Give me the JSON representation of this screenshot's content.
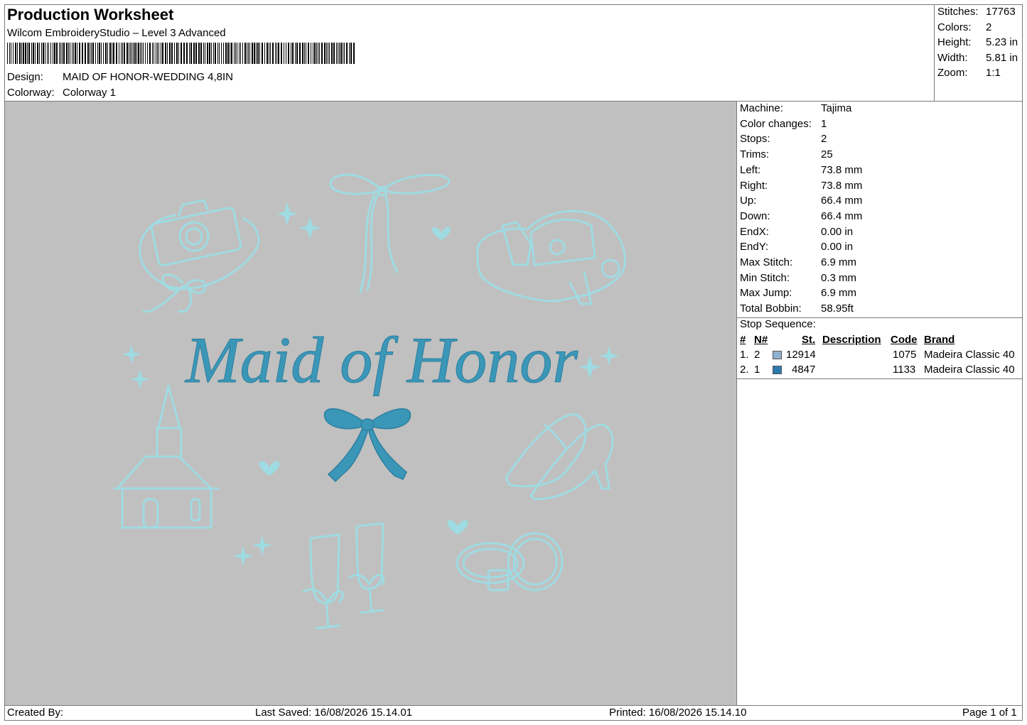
{
  "header": {
    "title": "Production Worksheet",
    "software": "Wilcom EmbroideryStudio – Level 3 Advanced",
    "design_label": "Design:",
    "design_value": "MAID OF HONOR-WEDDING 4,8IN",
    "colorway_label": "Colorway:",
    "colorway_value": "Colorway 1"
  },
  "summary": [
    {
      "label": "Stitches:",
      "value": "17763"
    },
    {
      "label": "Colors:",
      "value": "2"
    },
    {
      "label": "Height:",
      "value": "5.23 in"
    },
    {
      "label": "Width:",
      "value": "5.81 in"
    },
    {
      "label": "Zoom:",
      "value": "1:1"
    }
  ],
  "machine_info": [
    {
      "label": "Machine:",
      "value": "Tajima"
    },
    {
      "label": "Color changes:",
      "value": "1"
    },
    {
      "label": "Stops:",
      "value": "2"
    },
    {
      "label": "Trims:",
      "value": "25"
    },
    {
      "label": "Left:",
      "value": "73.8 mm"
    },
    {
      "label": "Right:",
      "value": "73.8 mm"
    },
    {
      "label": "Up:",
      "value": "66.4 mm"
    },
    {
      "label": "Down:",
      "value": "66.4 mm"
    },
    {
      "label": "EndX:",
      "value": "0.00 in"
    },
    {
      "label": "EndY:",
      "value": "0.00 in"
    },
    {
      "label": "Max Stitch:",
      "value": "6.9 mm"
    },
    {
      "label": "Min Stitch:",
      "value": "0.3 mm"
    },
    {
      "label": "Max Jump:",
      "value": "6.9 mm"
    },
    {
      "label": "Total Bobbin:",
      "value": "58.95ft"
    }
  ],
  "stop_sequence": {
    "title": "Stop Sequence:",
    "headers": {
      "num": "#",
      "n": "N#",
      "st": "St.",
      "description": "Description",
      "code": "Code",
      "brand": "Brand"
    },
    "rows": [
      {
        "num": "1.",
        "n": "2",
        "color": "#8fb0cf",
        "st": "12914",
        "description": "",
        "code": "1075",
        "brand": "Madeira Classic 40"
      },
      {
        "num": "2.",
        "n": "1",
        "color": "#2a7ab0",
        "st": "4847",
        "description": "",
        "code": "1133",
        "brand": "Madeira Classic 40"
      }
    ]
  },
  "design_preview": {
    "text": "Maid of Honor",
    "thread_light": "#9fdbe2",
    "thread_dark": "#3b97b8",
    "background": "#c0c0c0"
  },
  "footer": {
    "created_by": "Created By:",
    "last_saved": "Last Saved: 16/08/2026 15.14.01",
    "printed": "Printed: 16/08/2026 15.14.10",
    "page": "Page 1 of 1"
  }
}
